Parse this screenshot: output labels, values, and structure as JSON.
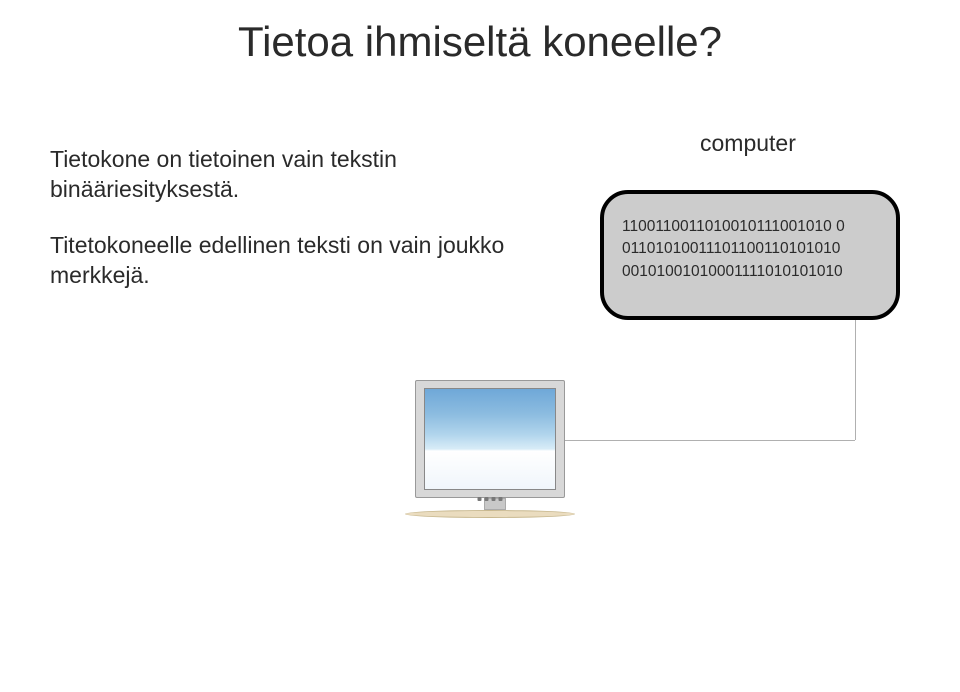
{
  "title": "Tietoa ihmiseltä koneelle?",
  "leftText": {
    "p1": "Tietokone on tietoinen vain tekstin binääriesityksestä.",
    "p2": "Titetokoneelle edellinen teksti on vain joukko merkkejä."
  },
  "computerLabel": "computer",
  "bubble": {
    "line1": "1100110011010010111001010 0",
    "line2": "01101010011101100110101010",
    "line3": "00101001010001111010101010"
  }
}
